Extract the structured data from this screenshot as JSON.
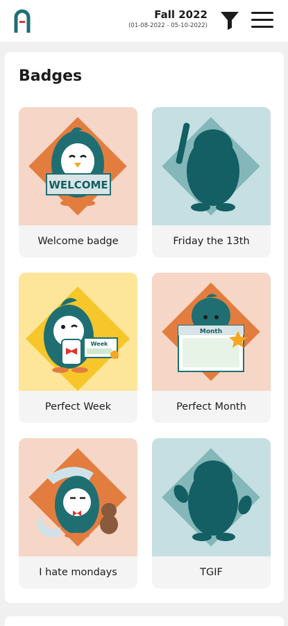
{
  "header": {
    "term_title": "Fall 2022",
    "term_range": "(01-08-2022 - 05-10-2022)",
    "logo_icon": "app-logo-icon",
    "filter_icon": "filter-icon",
    "menu_icon": "hamburger-menu-icon"
  },
  "badges_section": {
    "title": "Badges",
    "items": [
      {
        "label": "Welcome badge",
        "sign_text": "WELCOME",
        "status": "earned",
        "bg": "#f6d6c6"
      },
      {
        "label": "Friday the 13th",
        "status": "locked",
        "bg": "#c6dfe2"
      },
      {
        "label": "Perfect Week",
        "sign_text": "Week",
        "status": "earned",
        "bg": "#fde69a"
      },
      {
        "label": "Perfect Month",
        "sign_text": "Month",
        "status": "earned",
        "bg": "#f6d6c6"
      },
      {
        "label": "I hate mondays",
        "status": "earned",
        "bg": "#f6d6c6"
      },
      {
        "label": "TGIF",
        "status": "locked",
        "bg": "#c6dfe2"
      }
    ]
  },
  "colors": {
    "teal": "#1f6f72",
    "orange": "#e27d3f",
    "red": "#e3342f",
    "locked": "#135f63"
  }
}
